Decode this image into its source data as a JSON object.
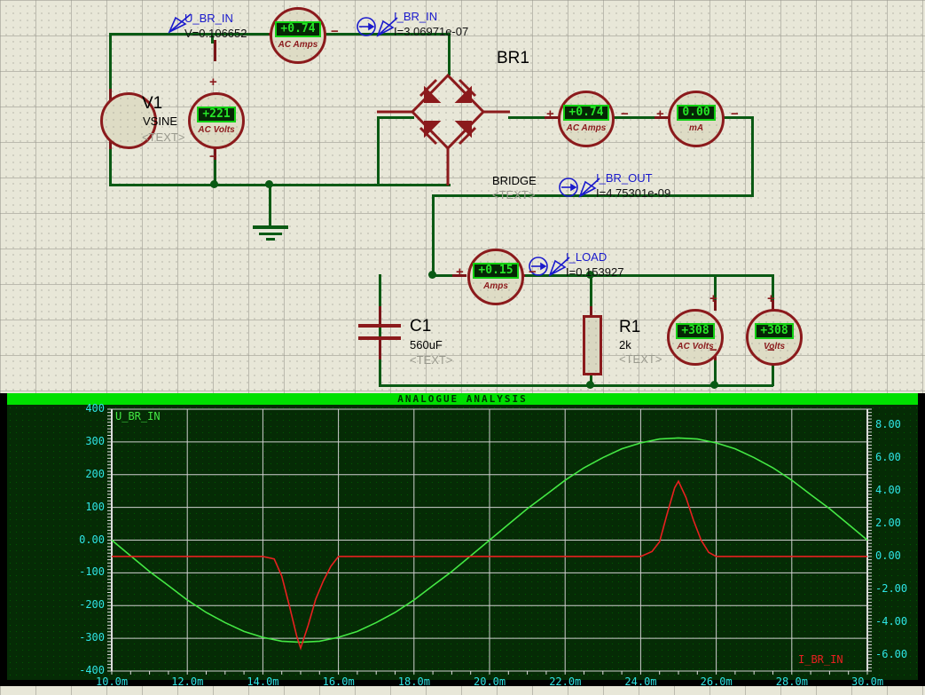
{
  "schematic": {
    "probes": [
      {
        "name": "U_BR_IN",
        "value": "V=0.106652",
        "type": "voltage-probe"
      },
      {
        "name": "I_BR_IN",
        "value": "I=3.06971e-07",
        "type": "current-probe"
      },
      {
        "name": "I_BR_OUT",
        "value": "I=4.75301e-09",
        "type": "current-probe"
      },
      {
        "name": "I_LOAD",
        "value": "I=0.153927",
        "type": "current-probe"
      }
    ],
    "components": [
      {
        "ref": "V1",
        "value": "VSINE",
        "text": "<TEXT>",
        "kind": "voltage-source"
      },
      {
        "ref": "BR1",
        "value": "BRIDGE",
        "text": "<TEXT>",
        "kind": "bridge-rectifier"
      },
      {
        "ref": "C1",
        "value": "560uF",
        "text": "<TEXT>",
        "kind": "capacitor"
      },
      {
        "ref": "R1",
        "value": "2k",
        "text": "<TEXT>",
        "kind": "resistor"
      }
    ],
    "meters": [
      {
        "id": "m-ac-amps-in",
        "reading": "+0.74",
        "unit": "AC Amps",
        "plus": "+",
        "minus": "−"
      },
      {
        "id": "m-ac-volts-src",
        "reading": "+221",
        "unit": "AC Volts",
        "plus": "+",
        "minus": "−"
      },
      {
        "id": "m-ac-amps-br",
        "reading": "+0.74",
        "unit": "AC Amps",
        "plus": "+",
        "minus": "−"
      },
      {
        "id": "m-ma",
        "reading": "0.00",
        "unit": "mA",
        "plus": "+",
        "minus": "−"
      },
      {
        "id": "m-amps-load",
        "reading": "+0.15",
        "unit": "Amps",
        "plus": "+",
        "minus": "−"
      },
      {
        "id": "m-ac-volts-out",
        "reading": "+308",
        "unit": "AC Volts",
        "plus": "+",
        "minus": "−"
      },
      {
        "id": "m-volts-out",
        "reading": "+308",
        "unit": "Volts",
        "plus": "+",
        "minus": "−"
      }
    ]
  },
  "graph": {
    "title": "ANALOGUE ANALYSIS",
    "left_trace_label": "U_BR_IN",
    "right_trace_label": "I_BR_IN",
    "left_color": "#2ee5e5",
    "trace1_color": "#44e844",
    "trace2_color": "#e82020"
  },
  "chart_data": {
    "type": "line",
    "title": "ANALOGUE ANALYSIS",
    "xlabel": "",
    "ylabel": "",
    "xlim": [
      0.01,
      0.03
    ],
    "xticks": [
      0.01,
      0.012,
      0.014,
      0.016,
      0.018,
      0.02,
      0.022,
      0.024,
      0.026,
      0.028,
      0.03
    ],
    "xticklabels": [
      "10.0m",
      "12.0m",
      "14.0m",
      "16.0m",
      "18.0m",
      "20.0m",
      "22.0m",
      "24.0m",
      "26.0m",
      "28.0m",
      "30.0m"
    ],
    "left_axis": {
      "label": "U_BR_IN",
      "ylim": [
        -400,
        400
      ],
      "yticks": [
        -400,
        -300,
        -200,
        -100,
        0,
        100,
        200,
        300,
        400
      ],
      "yticklabels": [
        "-400",
        "-300",
        "-200",
        "-100",
        "0.00",
        "100",
        "200",
        "300",
        "400"
      ],
      "color": "#2ee5e5"
    },
    "right_axis": {
      "label": "I_BR_IN",
      "ylim": [
        -7.0,
        9.0
      ],
      "yticks": [
        -6,
        -4,
        -2,
        0,
        2,
        4,
        6,
        8
      ],
      "yticklabels": [
        "-6.00",
        "-4.00",
        "-2.00",
        "0.00",
        "2.00",
        "4.00",
        "6.00",
        "8.00"
      ],
      "color": "#2ee5e5"
    },
    "grid": true,
    "legend": false,
    "series": [
      {
        "name": "U_BR_IN",
        "axis": "left",
        "color": "#44e844",
        "description": "50 Hz sine wave, amplitude ~312 V, period 20 ms, starting near 0 V and going negative first",
        "x": [
          0.01,
          0.0105,
          0.011,
          0.0115,
          0.012,
          0.0125,
          0.013,
          0.0135,
          0.014,
          0.0145,
          0.015,
          0.0155,
          0.016,
          0.0165,
          0.017,
          0.0175,
          0.018,
          0.0185,
          0.019,
          0.0195,
          0.02,
          0.0205,
          0.021,
          0.0215,
          0.022,
          0.0225,
          0.023,
          0.0235,
          0.024,
          0.0245,
          0.025,
          0.0255,
          0.026,
          0.0265,
          0.027,
          0.0275,
          0.028,
          0.0285,
          0.029,
          0.0295,
          0.03
        ],
        "y": [
          0,
          -48,
          -96,
          -139,
          -183,
          -221,
          -252,
          -279,
          -297,
          -309,
          -312,
          -309,
          -297,
          -279,
          -252,
          -221,
          -183,
          -139,
          -96,
          -48,
          0,
          48,
          96,
          139,
          183,
          221,
          252,
          279,
          297,
          309,
          312,
          309,
          297,
          279,
          252,
          221,
          183,
          139,
          96,
          48,
          0
        ]
      },
      {
        "name": "I_BR_IN",
        "axis": "right",
        "color": "#e82020",
        "description": "Rectifier input current: flat at 0 A with a narrow negative spike to about -5.6 A near t=15 ms and a narrow positive spike to about +4.6 A near t=25 ms",
        "x": [
          0.01,
          0.014,
          0.0143,
          0.0145,
          0.0147,
          0.0149,
          0.015,
          0.0152,
          0.0154,
          0.0156,
          0.0158,
          0.016,
          0.02,
          0.024,
          0.0243,
          0.0245,
          0.0247,
          0.0249,
          0.025,
          0.0252,
          0.0254,
          0.0256,
          0.0258,
          0.026,
          0.03
        ],
        "y": [
          0,
          0,
          -0.15,
          -1.2,
          -3.0,
          -4.9,
          -5.6,
          -4.2,
          -2.6,
          -1.5,
          -0.6,
          0,
          0,
          0,
          0.3,
          0.9,
          2.6,
          4.2,
          4.6,
          3.6,
          2.2,
          1.0,
          0.25,
          0,
          0
        ]
      }
    ]
  }
}
